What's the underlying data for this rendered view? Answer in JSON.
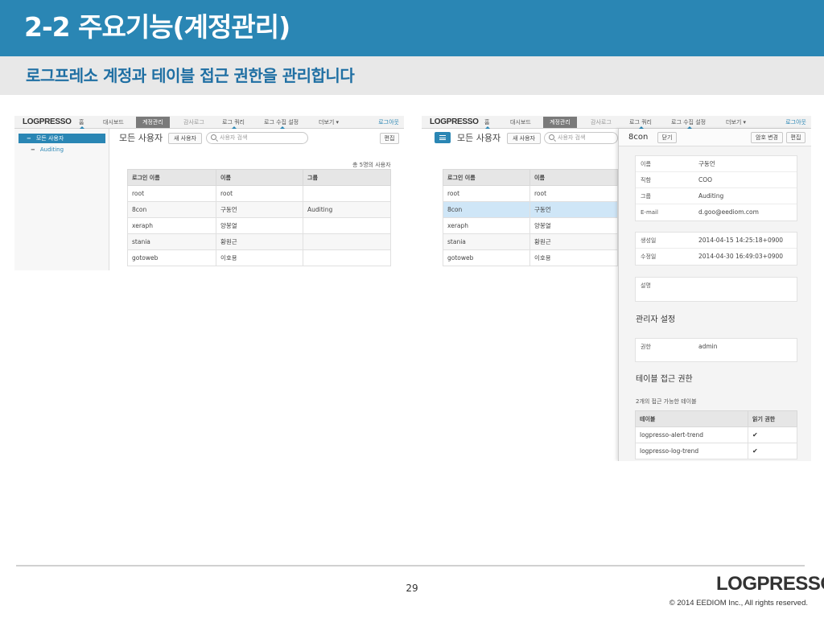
{
  "slide": {
    "title": "2-2 주요기능(계정관리)",
    "subtitle": "로그프레소 계정과 테이블 접근 권한을 관리합니다",
    "page_number": "29",
    "footer_logo": "LOGPRESSO",
    "copyright": "© 2014 EEDIOM Inc., All rights reserved."
  },
  "app": {
    "logo": "LOGPRESSO",
    "nav": [
      "홈",
      "대시보드",
      "계정관리",
      "감사로그",
      "로그 쿼리",
      "로그 수집 설정",
      "더보기 ▾"
    ],
    "active_nav": "계정관리",
    "logout": "로그아웃"
  },
  "left": {
    "sidebar": {
      "selected": "모든 사용자",
      "sub": "Auditing"
    },
    "toolbar": {
      "title": "모든 사용자",
      "new_user": "새 사용자",
      "search_placeholder": "사용자 검색",
      "edit": "편집"
    },
    "count": "총 5명의 사용자",
    "table": {
      "headers": [
        "로그인 이름",
        "이름",
        "그룹"
      ],
      "rows": [
        [
          "root",
          "root",
          ""
        ],
        [
          "8con",
          "구동언",
          "Auditing"
        ],
        [
          "xeraph",
          "양봉열",
          ""
        ],
        [
          "stania",
          "황원근",
          ""
        ],
        [
          "gotoweb",
          "이호용",
          ""
        ]
      ]
    }
  },
  "right": {
    "toolbar": {
      "title": "모든 사용자",
      "new_user": "새 사용자",
      "search_placeholder": "사용자 검색"
    },
    "table": {
      "headers": [
        "로그인 이름",
        "이름"
      ],
      "rows": [
        [
          "root",
          "root"
        ],
        [
          "8con",
          "구동언"
        ],
        [
          "xeraph",
          "양봉열"
        ],
        [
          "stania",
          "황원근"
        ],
        [
          "gotoweb",
          "이호용"
        ]
      ],
      "selected_row": "8con"
    },
    "detail": {
      "name": "8con",
      "close": "닫기",
      "change_password": "암호 변경",
      "edit": "편집",
      "profile": [
        {
          "k": "이름",
          "v": "구동언"
        },
        {
          "k": "직함",
          "v": "COO"
        },
        {
          "k": "그룹",
          "v": "Auditing"
        },
        {
          "k": "E-mail",
          "v": "d.goo@eediom.com"
        }
      ],
      "dates": [
        {
          "k": "생성일",
          "v": "2014-04-15 14:25:18+0900"
        },
        {
          "k": "수정일",
          "v": "2014-04-30 16:49:03+0900"
        }
      ],
      "description_label": "설명",
      "admin_section": "관리자 설정",
      "permission": {
        "k": "권한",
        "v": "admin"
      },
      "table_section": "테이블 접근 권한",
      "table_note": "2개의 접근 가능한 테이블",
      "table_headers": [
        "테이블",
        "읽기 권한"
      ],
      "tables": [
        {
          "name": "logpresso-alert-trend",
          "read": "✔"
        },
        {
          "name": "logpresso-log-trend",
          "read": "✔"
        }
      ]
    }
  },
  "colors": {
    "brand_blue": "#2a86b4",
    "logo_accent": "#e8731a"
  }
}
